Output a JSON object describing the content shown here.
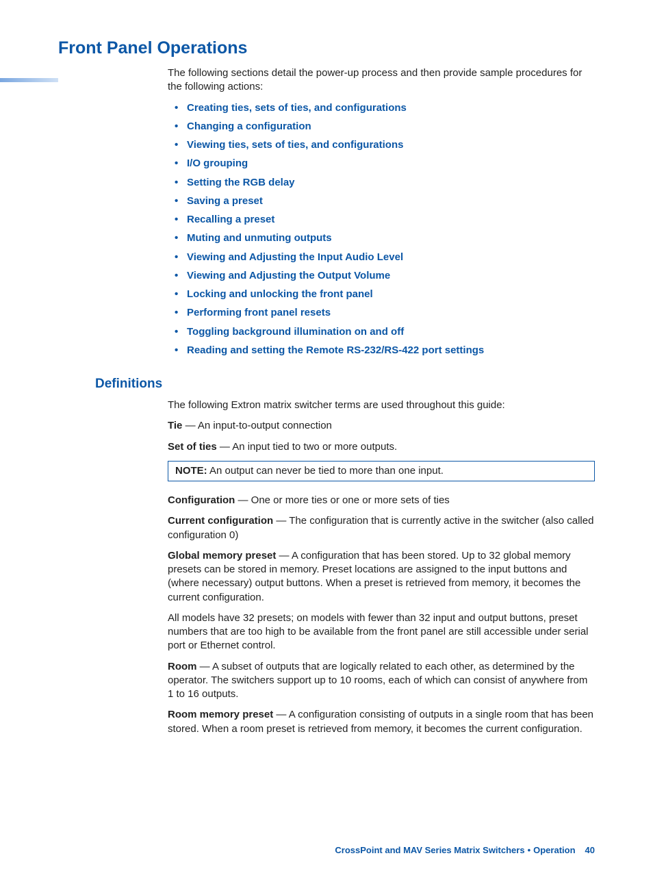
{
  "heading": "Front Panel Operations",
  "intro": "The following sections detail the power-up process and then provide sample procedures for the following actions:",
  "actions": [
    "Creating ties, sets of ties, and configurations",
    "Changing a configuration",
    "Viewing ties, sets of ties, and configurations",
    "I/O grouping",
    "Setting the RGB delay",
    "Saving a preset",
    "Recalling a preset",
    "Muting and unmuting outputs",
    "Viewing and Adjusting the Input Audio Level",
    "Viewing and Adjusting the Output Volume",
    "Locking and unlocking the front panel",
    "Performing front panel resets",
    "Toggling background illumination on and off",
    "Reading and setting the Remote RS-232/RS-422 port settings"
  ],
  "definitions": {
    "title": "Definitions",
    "intro": "The following Extron matrix switcher terms are used throughout this guide:",
    "items": [
      {
        "term": "Tie",
        "desc": " — An input-to-output connection"
      },
      {
        "term": "Set of ties",
        "desc": " — An input tied to two or more outputs."
      }
    ],
    "note_label": "NOTE:",
    "note_text": "An output can never be tied to more than one input.",
    "items2": [
      {
        "term": "Configuration",
        "desc": " — One or more ties or one or more sets of ties"
      },
      {
        "term": "Current configuration",
        "desc": " — The configuration that is currently active in the switcher (also called configuration 0)"
      },
      {
        "term": "Global memory preset",
        "desc": " — A configuration that has been stored. Up to 32 global memory presets can be stored in memory. Preset locations are assigned to the input buttons and (where necessary) output buttons. When a preset is retrieved from memory, it becomes the current configuration."
      }
    ],
    "extra_para": "All models have 32 presets; on models with fewer than 32 input and output buttons, preset numbers that are too high to be available from the front panel are still accessible under serial port or Ethernet control.",
    "items3": [
      {
        "term": "Room",
        "desc": " — A subset of outputs that are logically related to each other, as determined by the operator. The switchers support up to 10 rooms, each of which can consist of anywhere from 1 to 16 outputs."
      },
      {
        "term": "Room memory preset",
        "desc": " — A configuration consisting of outputs in a single room that has been stored. When a room preset is retrieved from memory, it becomes the current configuration."
      }
    ]
  },
  "footer": {
    "product": "CrossPoint and MAV Series Matrix Switchers",
    "section": "Operation",
    "page": "40"
  }
}
